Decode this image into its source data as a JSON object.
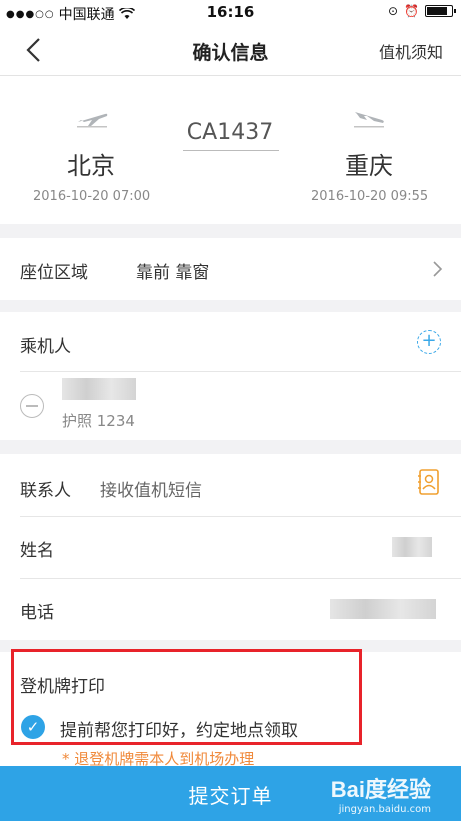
{
  "status_bar": {
    "carrier": "中国联通",
    "time": "16:16"
  },
  "nav": {
    "title": "确认信息",
    "right_link": "值机须知"
  },
  "flight": {
    "number": "CA1437",
    "departure": {
      "city": "北京",
      "datetime": "2016-10-20 07:00"
    },
    "arrival": {
      "city": "重庆",
      "datetime": "2016-10-20 09:55"
    }
  },
  "seat": {
    "label": "座位区域",
    "value": "靠前 靠窗"
  },
  "passenger": {
    "label": "乘机人",
    "document": "护照 1234"
  },
  "contact": {
    "label": "联系人",
    "hint": "接收值机短信",
    "name_label": "姓名",
    "phone_label": "电话"
  },
  "boarding_pass": {
    "title": "登机牌打印",
    "option": "提前帮您打印好，约定地点领取",
    "note": "* 退登机牌需本人到机场办理"
  },
  "submit": {
    "label": "提交订单"
  },
  "watermark": {
    "brand": "Bai度经验",
    "url": "jingyan.baidu.com"
  },
  "colors": {
    "accent": "#2ea3e6",
    "highlight_box": "#e8232a",
    "note_orange": "#f08a3c"
  }
}
